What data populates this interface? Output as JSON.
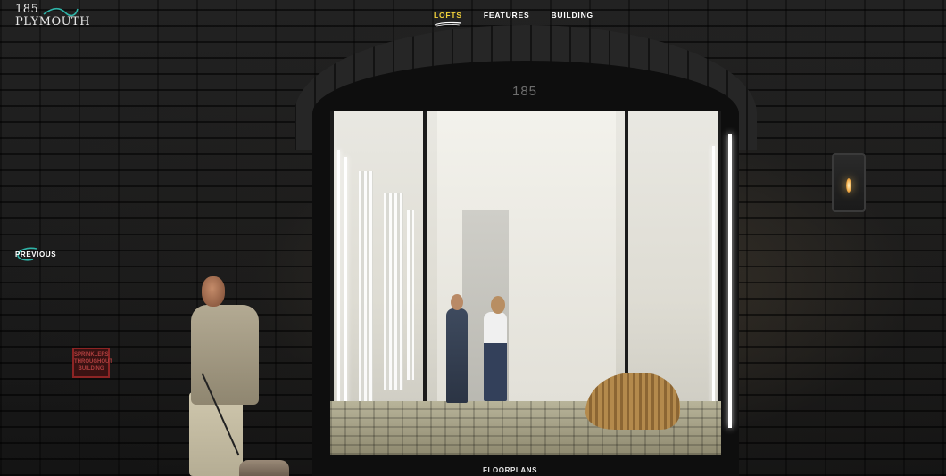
{
  "logo": {
    "line1": "185",
    "line2": "PLYMOUTH"
  },
  "nav": {
    "items": [
      {
        "label": "LOFTS",
        "active": true
      },
      {
        "label": "FEATURES",
        "active": false
      },
      {
        "label": "BUILDING",
        "active": false
      }
    ]
  },
  "gallery": {
    "previous_label": "PREVIOUS",
    "floorplans_label": "FLOORPLANS"
  },
  "scene": {
    "address_number": "185",
    "sign_text": [
      "SPRINKLERS",
      "THROUGHOUT",
      "BUILDING"
    ]
  },
  "colors": {
    "accent_active_nav": "#f2d23a",
    "accent_teal": "#2fb4a8",
    "text_white": "#ffffff"
  }
}
